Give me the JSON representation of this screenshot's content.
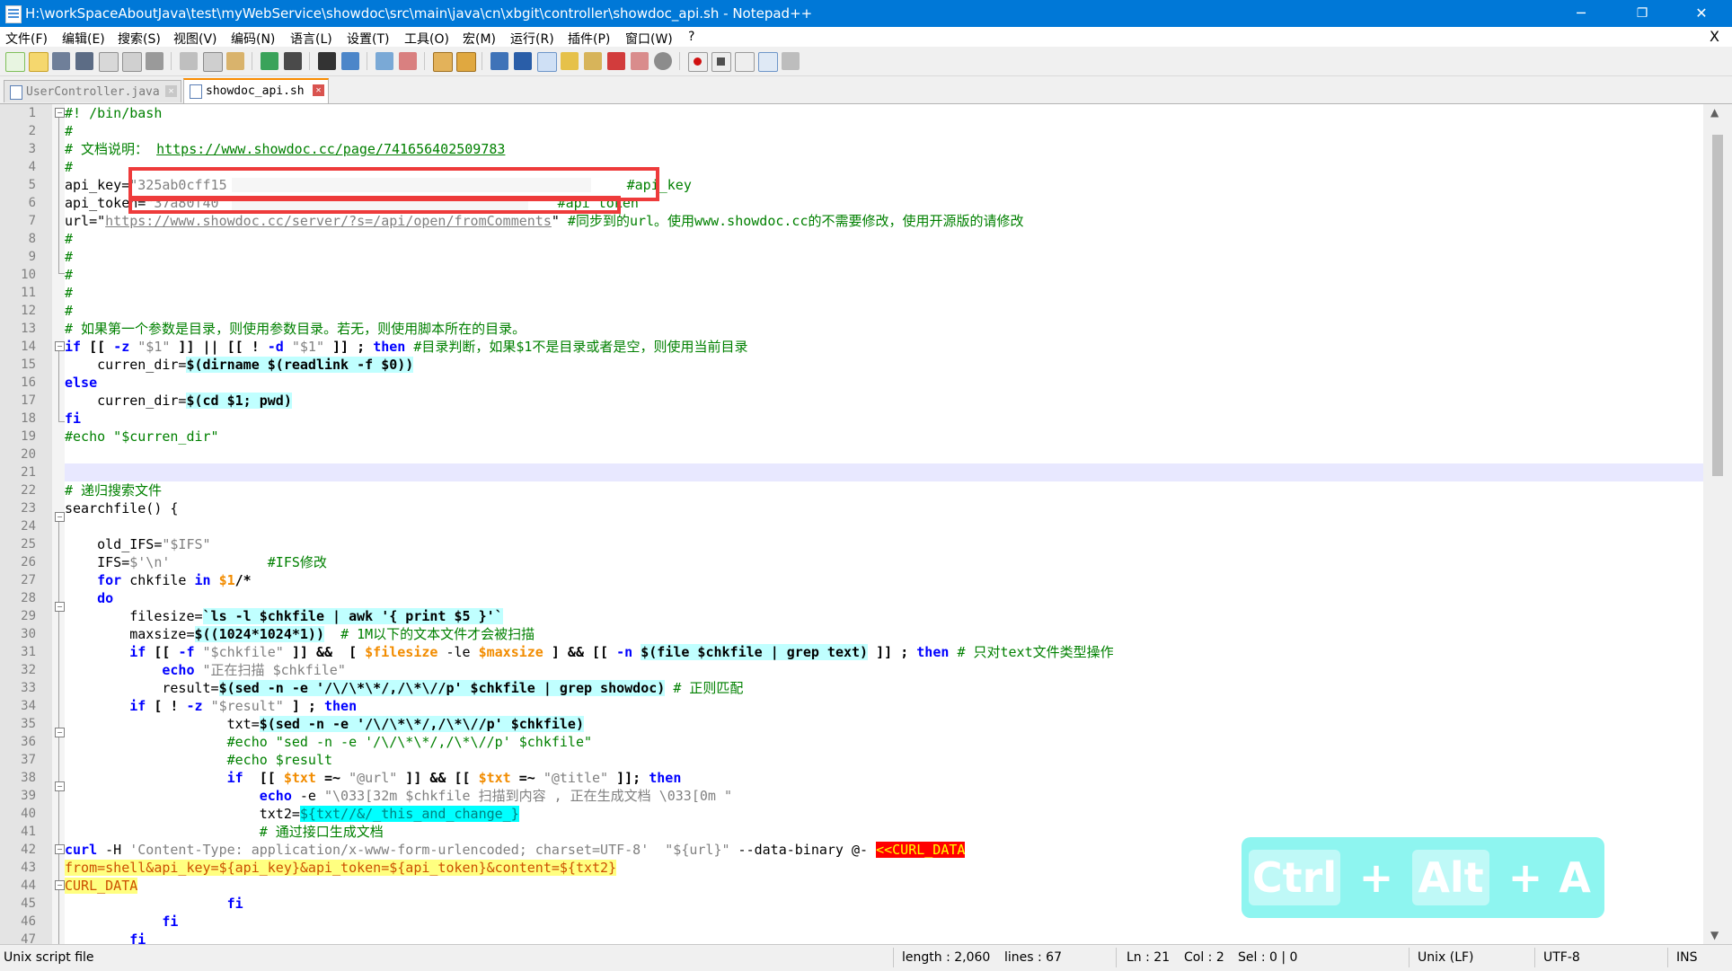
{
  "window": {
    "title": "H:\\workSpaceAboutJava\\test\\myWebService\\showdoc\\src\\main\\java\\cn\\xbgit\\controller\\showdoc_api.sh - Notepad++",
    "minimize": "─",
    "maximize": "❐",
    "close": "✕"
  },
  "menu": {
    "items": [
      "文件(F)",
      "编辑(E)",
      "搜索(S)",
      "视图(V)",
      "编码(N)",
      "语言(L)",
      "设置(T)",
      "工具(O)",
      "宏(M)",
      "运行(R)",
      "插件(P)",
      "窗口(W)",
      "?"
    ],
    "close": "X"
  },
  "toolbar": {
    "icons": [
      "new-file-icon",
      "open-file-icon",
      "save-icon",
      "save-all-icon",
      "close-icon",
      "close-all-icon",
      "print-icon",
      "cut-icon",
      "copy-icon",
      "paste-icon",
      "undo-icon",
      "redo-icon",
      "find-icon",
      "replace-icon",
      "zoom-in-icon",
      "zoom-out-icon",
      "sync-vertical-icon",
      "sync-horizontal-icon",
      "word-wrap-icon",
      "show-all-chars-icon",
      "indent-guide-icon",
      "udl-icon",
      "doc-map-icon",
      "function-list-icon",
      "folder-workspace-icon",
      "monitor-icon",
      "record-macro-icon",
      "stop-macro-icon",
      "play-macro-icon",
      "run-macro-multiple-icon",
      "save-macro-icon"
    ]
  },
  "tabs": [
    {
      "label": "UserController.java",
      "active": false
    },
    {
      "label": "showdoc_api.sh",
      "active": true
    }
  ],
  "editor": {
    "line_numbers": [
      "1",
      "2",
      "3",
      "4",
      "5",
      "6",
      "7",
      "8",
      "9",
      "10",
      "11",
      "12",
      "13",
      "14",
      "15",
      "16",
      "17",
      "18",
      "19",
      "20",
      "21",
      "22",
      "23",
      "24",
      "25",
      "26",
      "27",
      "28",
      "29",
      "30",
      "31",
      "32",
      "33",
      "34",
      "35",
      "36",
      "37",
      "38",
      "39",
      "40",
      "41",
      "42",
      "43",
      "44",
      "45",
      "46",
      "47"
    ],
    "current_line": 21
  },
  "code": {
    "l1": "#! /bin/bash",
    "l2": "#",
    "l3_prefix": "# 文档说明： ",
    "l3_url": "https://www.showdoc.cc/page/741656402509783",
    "l4": "#",
    "l5_key": "api_key=",
    "l5_val": "\"325ab0cff15",
    "l5_comment": "#api_key",
    "l6_key": "api_token=",
    "l6_val": "\"37a80f40",
    "l6_comment": "#api_token",
    "l7_key": "url=\"",
    "l7_url": "https://www.showdoc.cc/server/?s=/api/open/fromComments",
    "l7_end": "\" ",
    "l7_comment": "#同步到的url。使用www.showdoc.cc的不需要修改，使用开源版的请修改",
    "l8": "#",
    "l9": "#",
    "l10": "#",
    "l11": "#",
    "l12": "#",
    "l13": "# 如果第一个参数是目录，则使用参数目录。若无，则使用脚本所在的目录。",
    "l14_a": "if",
    "l14_b": " [[ ",
    "l14_c": "-z",
    "l14_d": " ",
    "l14_e": "\"$1\"",
    "l14_f": " ]] || [[ ! ",
    "l14_g": "-d",
    "l14_h": " ",
    "l14_i": "\"$1\"",
    "l14_j": " ]] ; ",
    "l14_k": "then",
    "l14_l": " ",
    "l14_m": "#目录判断，如果$1不是目录或者是空，则使用当前目录",
    "l15_a": "    curren_dir=",
    "l15_b": "$(dirname $(readlink -f $0))",
    "l16": "else",
    "l17_a": "    curren_dir=",
    "l17_b": "$(cd $1; pwd)",
    "l18": "fi",
    "l19": "#echo \"$curren_dir\"",
    "l20": "",
    "l21": "",
    "l22": "# 递归搜索文件",
    "l23": "searchfile() {",
    "l24": "",
    "l25_a": "    old_IFS=",
    "l25_b": "\"$IFS\"",
    "l26_a": "    IFS=",
    "l26_b": "$'\\n'",
    "l26_c": "            ",
    "l26_d": "#IFS修改",
    "l27_a": "    ",
    "l27_b": "for",
    "l27_c": " chkfile ",
    "l27_d": "in",
    "l27_e": " ",
    "l27_f": "$1",
    "l27_g": "/*",
    "l28_a": "    ",
    "l28_b": "do",
    "l29_a": "        filesize=",
    "l29_b": "`ls -l $chkfile | awk '{ print $5 }'`",
    "l30_a": "        maxsize=",
    "l30_b": "$((1024*1024*1))",
    "l30_c": "  ",
    "l30_d": "# 1M以下的文本文件才会被扫描",
    "l31_a": "        ",
    "l31_b": "if",
    "l31_c": " [[ ",
    "l31_d": "-f",
    "l31_e": " ",
    "l31_f": "\"$chkfile\"",
    "l31_g": " ]] ",
    "l31_h": "&&",
    "l31_i": "  [ ",
    "l31_j": "$filesize",
    "l31_k": " -le ",
    "l31_l": "$maxsize",
    "l31_m": " ] && [[ ",
    "l31_n": "-n",
    "l31_o": " ",
    "l31_p": "$(file $chkfile | grep text)",
    "l31_q": " ]] ; ",
    "l31_r": "then",
    "l31_s": " ",
    "l31_t": "# 只对text文件类型操作",
    "l32_a": "            ",
    "l32_b": "echo",
    "l32_c": " ",
    "l32_d": "\"正在扫描 $chkfile\"",
    "l33_a": "            result=",
    "l33_b": "$(sed -n -e '/\\/\\*\\*/,/\\*\\//p' $chkfile | grep showdoc)",
    "l33_c": " ",
    "l33_d": "# 正则匹配",
    "l34_a": "        ",
    "l34_b": "if",
    "l34_c": " [ ! ",
    "l34_d": "-z",
    "l34_e": " ",
    "l34_f": "\"$result\"",
    "l34_g": " ] ; ",
    "l34_h": "then",
    "l35_a": "                    txt=",
    "l35_b": "$(sed -n -e '/\\/\\*\\*/,/\\*\\//p' $chkfile)",
    "l36": "                    #echo \"sed -n -e '/\\/\\*\\*/,/\\*\\//p' $chkfile\"",
    "l37": "                    #echo $result",
    "l38_a": "                    ",
    "l38_b": "if",
    "l38_c": "  [[ ",
    "l38_d": "$txt",
    "l38_e": " =~ ",
    "l38_f": "\"@url\"",
    "l38_g": " ]] && [[ ",
    "l38_h": "$txt",
    "l38_i": " =~ ",
    "l38_j": "\"@title\"",
    "l38_k": " ]]; ",
    "l38_l": "then",
    "l39_a": "                        ",
    "l39_b": "echo",
    "l39_c": " -e ",
    "l39_d": "\"\\033[32m $chkfile 扫描到内容 , 正在生成文档 \\033[0m \"",
    "l40_a": "                        txt2=",
    "l40_b": "${txt//&/_this_and_change_}",
    "l41": "                        # 通过接口生成文档",
    "l42_a": "curl",
    "l42_b": " -H ",
    "l42_c": "'Content-Type: application/x-www-form-urlencoded; charset=UTF-8'",
    "l42_d": "  ",
    "l42_e": "\"${url}\"",
    "l42_f": " --data-binary @- ",
    "l42_g": "<<CURL_DATA",
    "l43": "from=shell&api_key=${api_key}&api_token=${api_token}&content=${txt2}",
    "l44": "CURL_DATA",
    "l45_a": "                    ",
    "l45_b": "fi",
    "l46_a": "            ",
    "l46_b": "fi",
    "l47_a": "        ",
    "l47_b": "fi"
  },
  "shortcut_overlay": {
    "key1": "Ctrl",
    "plus1": "+",
    "key2": "Alt",
    "plus2": "+",
    "key3": "A"
  },
  "status": {
    "filetype": "Unix script file",
    "length": "length : 2,060",
    "lines": "lines : 67",
    "ln": "Ln : 21",
    "col": "Col : 2",
    "sel": "Sel : 0 | 0",
    "eol": "Unix (LF)",
    "encoding": "UTF-8",
    "mode": "INS"
  },
  "colors": {
    "titlebar": "#0078d7",
    "comment": "#008000",
    "keyword": "#0000ff",
    "string": "#808080",
    "variable": "#f28c00",
    "current_line": "#e8e8ff",
    "redaction": "#ee3b3b",
    "overlay": "#8ef5f0"
  }
}
